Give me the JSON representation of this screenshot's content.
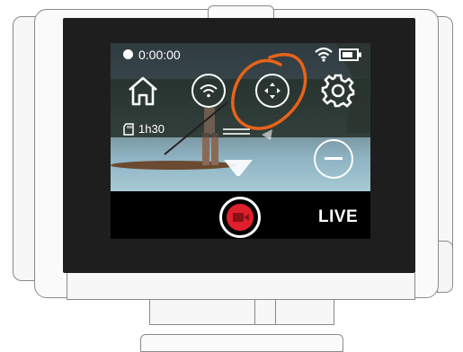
{
  "status": {
    "recording_time": "0:00:00",
    "storage_remaining": "1h30"
  },
  "controls": {
    "live_label": "LIVE"
  },
  "colors": {
    "highlight_stroke": "#e8631a",
    "record_red": "#e01f2d",
    "bezel": "#1e1e1e"
  },
  "icons": [
    "home-icon",
    "wifi-icon",
    "move-icon",
    "gear-icon",
    "minus-icon",
    "sd-card-icon",
    "battery-icon",
    "record-icon"
  ]
}
